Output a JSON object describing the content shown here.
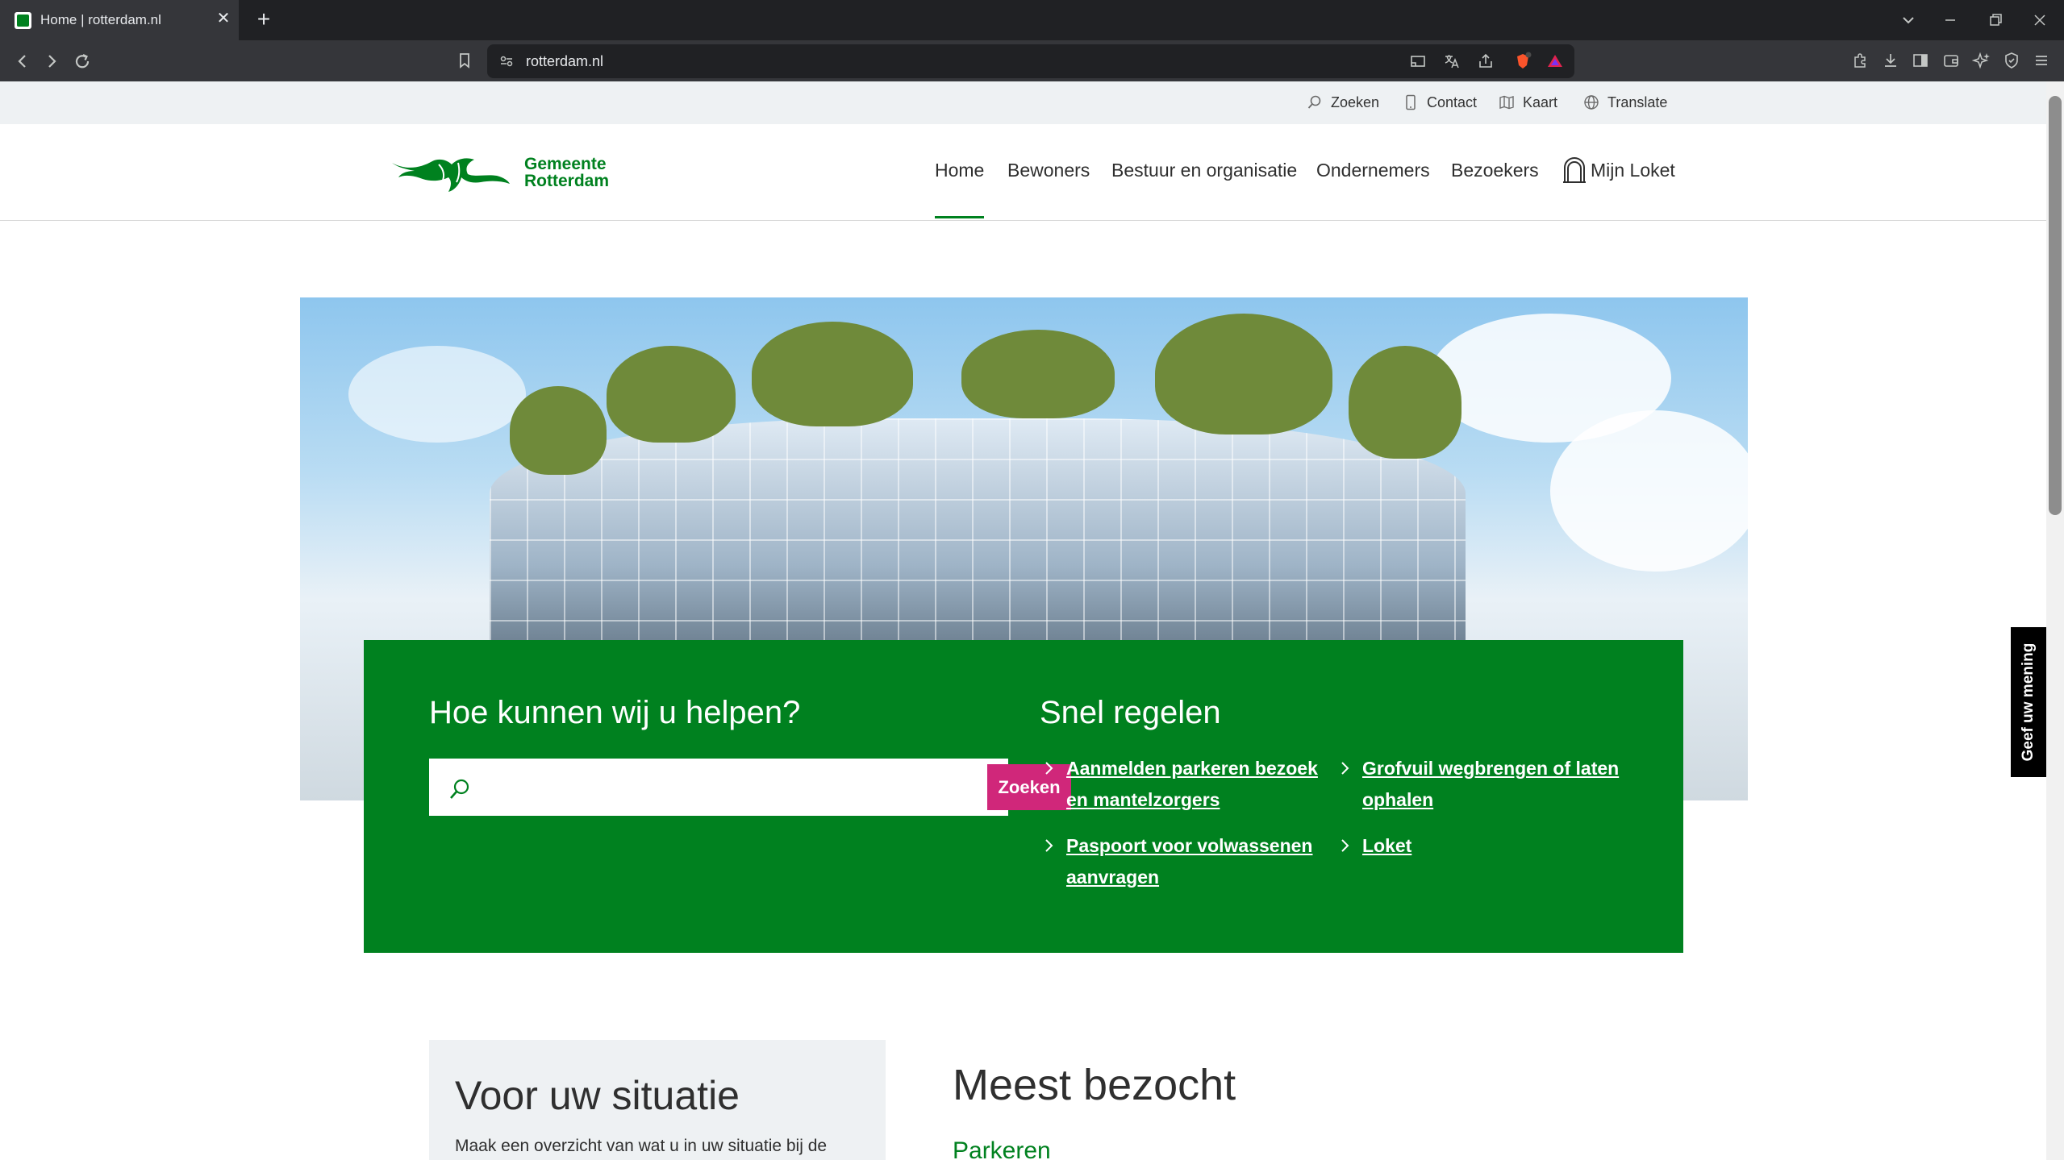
{
  "browser": {
    "tab_title": "Home | rotterdam.nl",
    "url": "rotterdam.nl",
    "new_tab_symbol": "+",
    "close_tab_symbol": "✕"
  },
  "utility": {
    "search": "Zoeken",
    "contact": "Contact",
    "map": "Kaart",
    "translate": "Translate"
  },
  "logo": {
    "line1": "Gemeente",
    "line2": "Rotterdam",
    "color": "#00811f"
  },
  "nav": {
    "items": [
      "Home",
      "Bewoners",
      "Bestuur en organisatie",
      "Ondernemers",
      "Bezoekers"
    ],
    "mijn_loket": "Mijn Loket",
    "active": "Home"
  },
  "help": {
    "title": "Hoe kunnen wij u helpen?",
    "search_placeholder": "",
    "search_button": "Zoeken",
    "button_color": "#d0277a",
    "panel_color": "#00811f"
  },
  "snel": {
    "title": "Snel regelen",
    "links": [
      "Aanmelden parkeren bezoek en mantelzorgers",
      "Grofvuil wegbrengen of laten ophalen",
      "Paspoort voor volwassenen aanvragen",
      "Loket"
    ]
  },
  "situation": {
    "title": "Voor uw situatie",
    "text": "Maak een overzicht van wat u in uw situatie bij de"
  },
  "meest": {
    "title": "Meest bezocht",
    "first_link": "Parkeren"
  },
  "feedback": {
    "label": "Geef uw mening"
  }
}
